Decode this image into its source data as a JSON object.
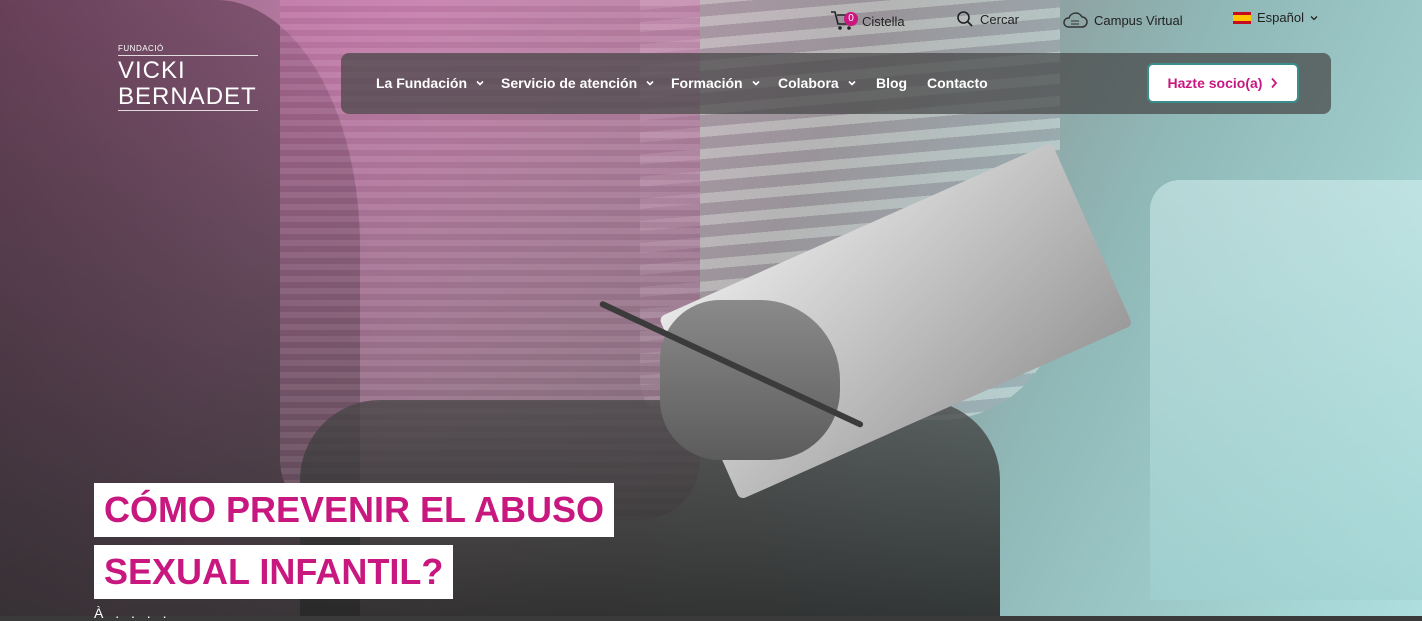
{
  "topbar": {
    "cart": {
      "count": "0",
      "label": "Cistella",
      "icon": "cart-icon"
    },
    "search": {
      "label": "Cercar",
      "icon": "search-icon"
    },
    "campus": {
      "label": "Campus Virtual",
      "icon": "cloud-icon"
    },
    "language": {
      "label": "Español",
      "icon": "spain-flag-icon"
    }
  },
  "logo": {
    "small": "FUNDACIÓ",
    "line1": "VICKI",
    "line2": "BERNADET"
  },
  "nav": {
    "items": [
      {
        "label": "La Fundación",
        "has_dropdown": true
      },
      {
        "label": "Servicio de atención",
        "has_dropdown": true
      },
      {
        "label": "Formación",
        "has_dropdown": true
      },
      {
        "label": "Colabora",
        "has_dropdown": true
      },
      {
        "label": "Blog",
        "has_dropdown": false
      },
      {
        "label": "Contacto",
        "has_dropdown": false
      }
    ],
    "cta": "Hazte socio(a)"
  },
  "hero": {
    "headline_line1": "CÓMO PREVENIR EL ABUSO",
    "headline_line2": "SEXUAL INFANTIL?",
    "peek_text": "À . . . ."
  },
  "colors": {
    "accent": "#c8187f",
    "nav_bg": "#464646",
    "cta_border": "#3a8e8c"
  }
}
